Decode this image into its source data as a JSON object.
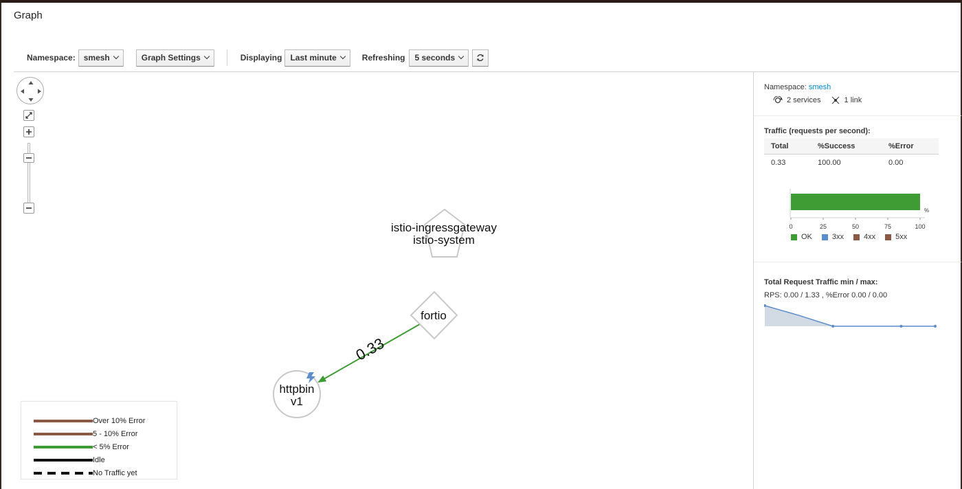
{
  "page": {
    "title": "Graph"
  },
  "toolbar": {
    "namespace_label": "Namespace:",
    "namespace_value": "smesh",
    "graph_settings_label": "Graph Settings",
    "displaying_label": "Displaying",
    "displaying_value": "Last minute",
    "refreshing_label": "Refreshing",
    "refreshing_value": "5 seconds",
    "refresh_icon": "refresh-icon"
  },
  "graph": {
    "nodes": [
      {
        "id": "gateway",
        "shape": "pentagon",
        "line1": "istio-ingressgateway",
        "line2": "istio-system"
      },
      {
        "id": "fortio",
        "shape": "diamond",
        "line1": "fortio"
      },
      {
        "id": "httpbin",
        "shape": "circle",
        "line1": "httpbin",
        "line2": "v1"
      }
    ],
    "edges": [
      {
        "from": "fortio",
        "to": "httpbin",
        "label": "0.33",
        "color": "#3f9c35"
      }
    ],
    "badge_icon": "virtual-service-icon"
  },
  "legend": [
    {
      "label": "Over 10% Error",
      "color": "#8b5a46",
      "style": "solid"
    },
    {
      "label": "5 - 10% Error",
      "color": "#8b5a46",
      "style": "solid"
    },
    {
      "label": "< 5% Error",
      "color": "#3f9c35",
      "style": "solid"
    },
    {
      "label": "Idle",
      "color": "#111111",
      "style": "solid"
    },
    {
      "label": "No Traffic yet",
      "color": "#111111",
      "style": "dashed"
    }
  ],
  "panel": {
    "namespace_label": "Namespace:",
    "namespace_value": "smesh",
    "services_text": "2 services",
    "links_text": "1 link",
    "traffic_title": "Traffic (requests per second):",
    "table": {
      "headers": [
        "Total",
        "%Success",
        "%Error"
      ],
      "row": [
        "0.33",
        "100.00",
        "0.00"
      ]
    },
    "bar_chart": {
      "ticks": [
        "0",
        "25",
        "50",
        "75",
        "100"
      ],
      "unit": "%",
      "ok_percent": 100,
      "legend": [
        {
          "label": "OK",
          "color": "#3f9c35"
        },
        {
          "label": "3xx",
          "color": "#5b8ccb"
        },
        {
          "label": "4xx",
          "color": "#8b5a46"
        },
        {
          "label": "5xx",
          "color": "#8b5a46"
        }
      ]
    },
    "total_title": "Total Request Traffic min / max:",
    "rps_text": "RPS: 0.00 / 1.33 , %Error 0.00 / 0.00"
  },
  "chart_data": {
    "type": "area",
    "x": [
      0,
      1,
      2,
      3,
      4,
      5
    ],
    "values": [
      1.33,
      0.7,
      0.0,
      0.0,
      0.0,
      0.0
    ],
    "ylim": [
      0,
      1.33
    ]
  }
}
